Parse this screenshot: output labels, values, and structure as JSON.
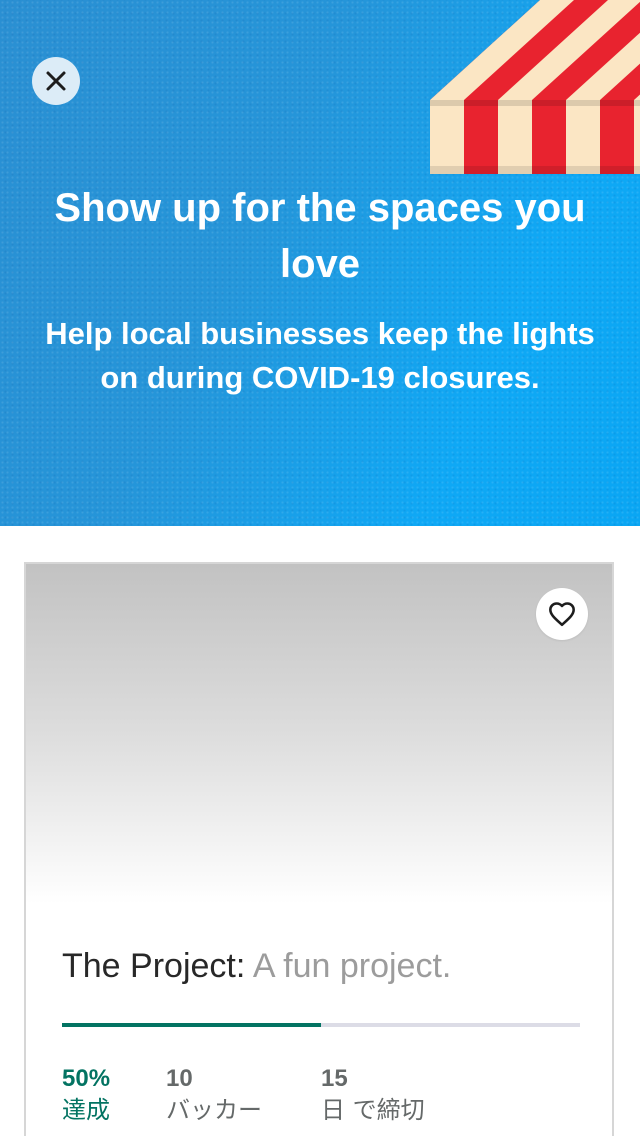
{
  "banner": {
    "title": "Show up for the spaces you love",
    "subtitle": "Help local businesses keep the lights on during COVID-19 closures.",
    "close_icon": "close-icon",
    "colors": {
      "background": "#1e9be3",
      "text": "#ffffff",
      "awning_red": "#e8232f",
      "awning_cream": "#fbe6c4"
    }
  },
  "project": {
    "name": "The Project:",
    "blurb": "A fun project.",
    "favorite_icon": "heart-icon",
    "progress_percent": 50,
    "colors": {
      "accent": "#037362",
      "track": "#dcdce6"
    },
    "stats": {
      "funded_value": "50%",
      "funded_label": "達成",
      "backers_value": "10",
      "backers_label": "バッカー",
      "days_value": "15",
      "days_label": "日 で締切"
    }
  }
}
